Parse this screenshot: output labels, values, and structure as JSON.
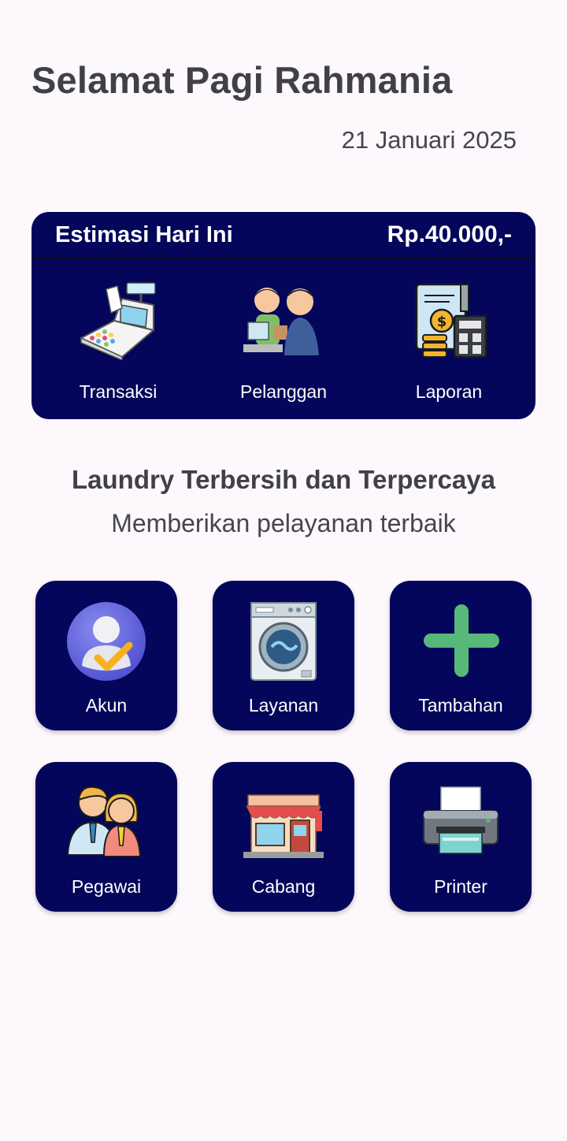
{
  "header": {
    "greeting": "Selamat Pagi Rahmania",
    "date": "21 Januari 2025"
  },
  "estimate_card": {
    "title": "Estimasi Hari Ini",
    "amount": "Rp.40.000,-",
    "menu": [
      {
        "label": "Transaksi",
        "icon": "cash-register-icon"
      },
      {
        "label": "Pelanggan",
        "icon": "customers-icon"
      },
      {
        "label": "Laporan",
        "icon": "report-calculator-icon"
      }
    ]
  },
  "tagline": {
    "title": "Laundry Terbersih dan Terpercaya",
    "subtitle": "Memberikan pelayanan terbaik"
  },
  "grid": [
    {
      "label": "Akun",
      "icon": "account-check-icon"
    },
    {
      "label": "Layanan",
      "icon": "washing-machine-icon"
    },
    {
      "label": "Tambahan",
      "icon": "plus-icon"
    },
    {
      "label": "Pegawai",
      "icon": "employees-icon"
    },
    {
      "label": "Cabang",
      "icon": "store-icon"
    },
    {
      "label": "Printer",
      "icon": "printer-icon"
    }
  ],
  "colors": {
    "primary": "#03065a",
    "background": "#fdf8fc",
    "plus_green": "#57b87a"
  }
}
